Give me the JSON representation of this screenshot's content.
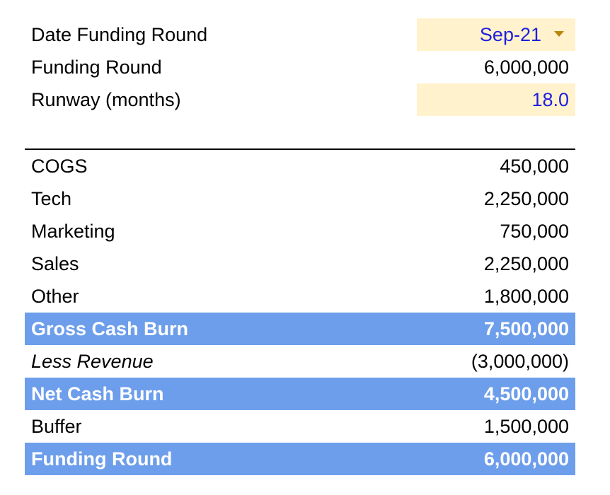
{
  "inputs": {
    "date_funding_round": {
      "label": "Date Funding Round",
      "value": "Sep-21"
    },
    "funding_round": {
      "label": "Funding Round",
      "value": "6,000,000"
    },
    "runway": {
      "label": "Runway (months)",
      "value": "18.0"
    }
  },
  "breakdown": {
    "rows": [
      {
        "label": "COGS",
        "value": "450,000"
      },
      {
        "label": "Tech",
        "value": "2,250,000"
      },
      {
        "label": "Marketing",
        "value": "750,000"
      },
      {
        "label": "Sales",
        "value": "2,250,000"
      },
      {
        "label": "Other",
        "value": "1,800,000"
      }
    ],
    "gross_cash_burn": {
      "label": "Gross Cash Burn",
      "value": "7,500,000"
    },
    "less_revenue": {
      "label": "Less Revenue",
      "value": "(3,000,000)"
    },
    "net_cash_burn": {
      "label": "Net Cash Burn",
      "value": "4,500,000"
    },
    "buffer": {
      "label": "Buffer",
      "value": "1,500,000"
    },
    "funding_round_total": {
      "label": "Funding Round",
      "value": "6,000,000"
    }
  },
  "colors": {
    "highlight_row": "#6d9eeb",
    "input_cell": "#fff2cc",
    "input_text": "#1f1fe0",
    "dropdown_arrow": "#b8860b"
  }
}
